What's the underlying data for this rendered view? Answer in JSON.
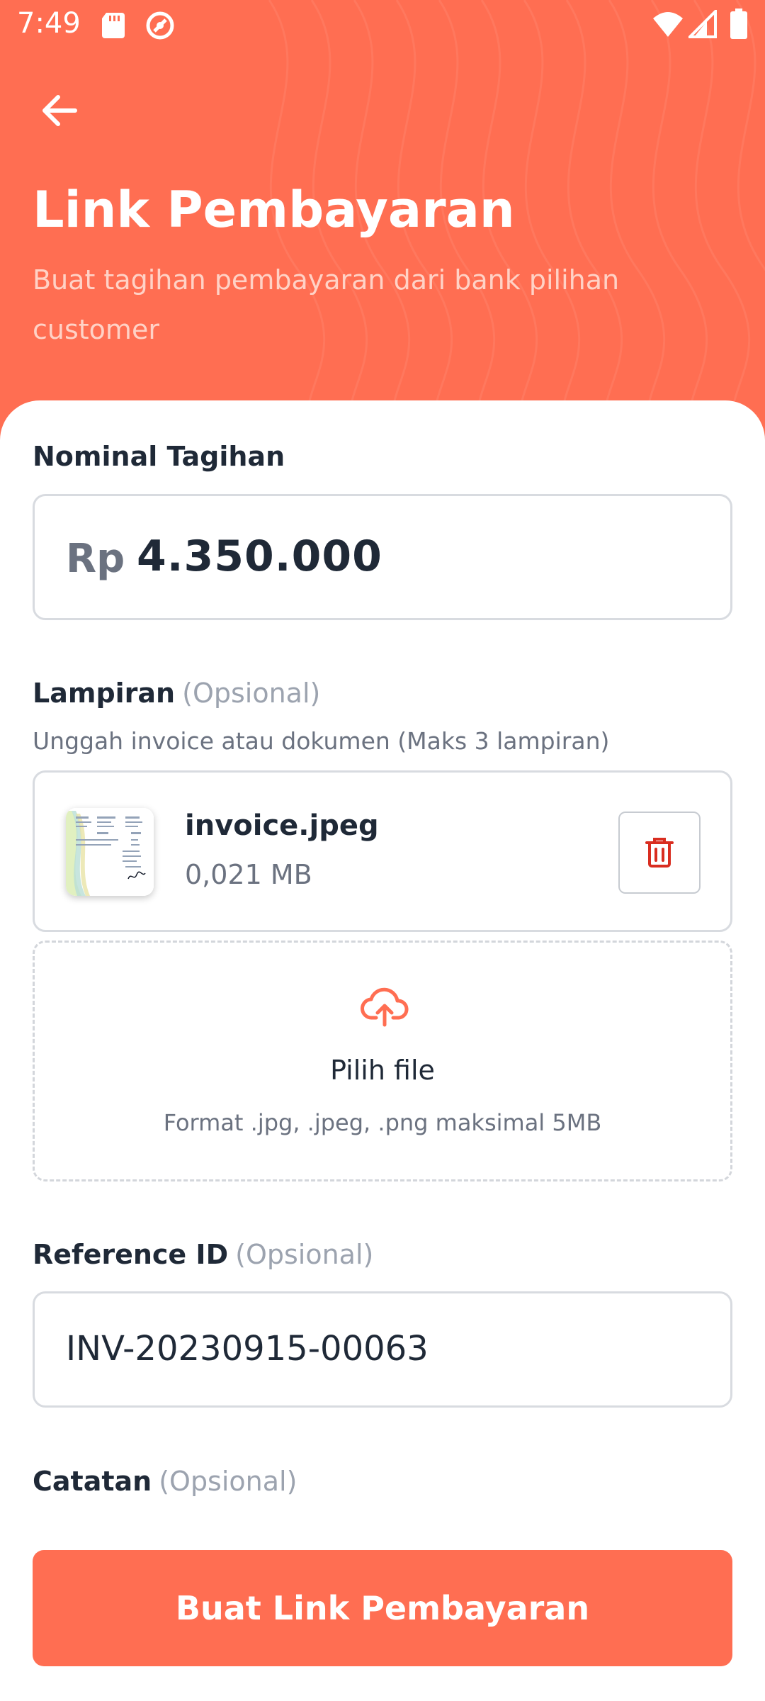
{
  "status_bar": {
    "time": "7:49",
    "icons": [
      "sd-card-icon",
      "sync-icon",
      "wifi-icon",
      "signal-icon",
      "battery-icon"
    ]
  },
  "header": {
    "back_icon": "arrow-left-icon",
    "title": "Link Pembayaran",
    "subtitle": "Buat tagihan pembayaran dari bank pilihan customer"
  },
  "form": {
    "amount": {
      "label": "Nominal Tagihan",
      "prefix": "Rp",
      "value": "4.350.000"
    },
    "attachment": {
      "label": "Lampiran",
      "optional": "(Opsional)",
      "helper": "Unggah invoice atau dokumen (Maks 3 lampiran)",
      "files": [
        {
          "name": "invoice.jpeg",
          "size": "0,021 MB"
        }
      ],
      "upload": {
        "title": "Pilih file",
        "hint": "Format .jpg, .jpeg, .png maksimal 5MB"
      }
    },
    "reference": {
      "label": "Reference ID",
      "optional": "(Opsional)",
      "value": "INV-20230915-00063"
    },
    "notes": {
      "label": "Catatan",
      "optional": "(Opsional)"
    },
    "submit_label": "Buat Link Pembayaran"
  },
  "colors": {
    "brand": "#FF6E52",
    "delete": "#D92D20",
    "text_primary": "#1F2937",
    "text_secondary": "#6B7280"
  }
}
